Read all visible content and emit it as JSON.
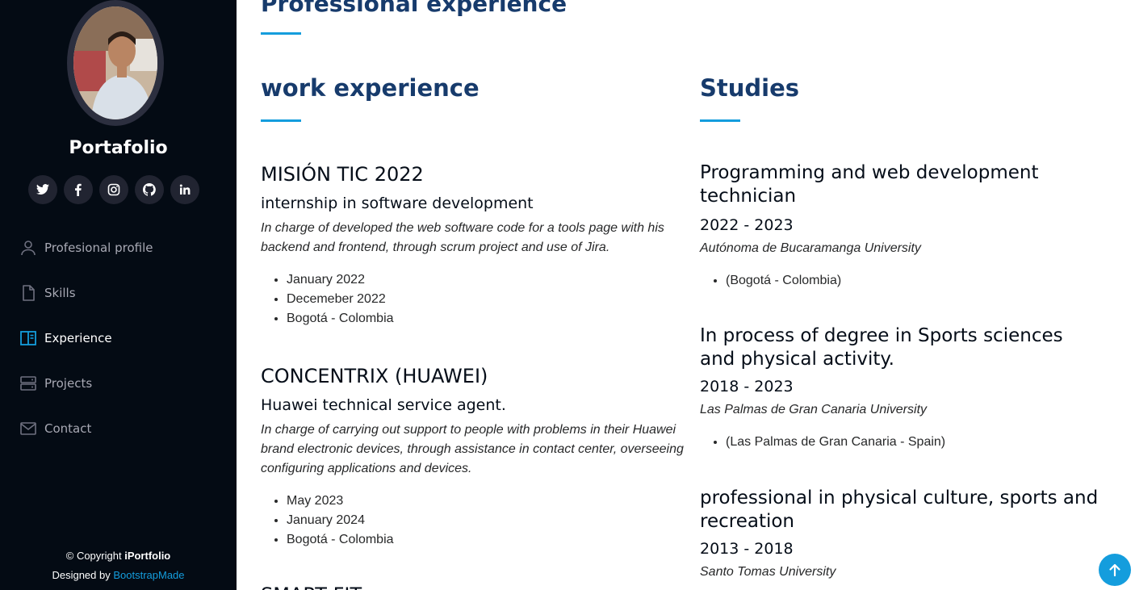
{
  "sidebar": {
    "brand": "Portafolio",
    "socials": [
      {
        "icon": "twitter-icon"
      },
      {
        "icon": "facebook-icon"
      },
      {
        "icon": "instagram-icon"
      },
      {
        "icon": "github-icon"
      },
      {
        "icon": "linkedin-icon"
      }
    ],
    "nav": [
      {
        "label": "Profesional profile",
        "icon": "person-icon"
      },
      {
        "label": "Skills",
        "icon": "file-icon"
      },
      {
        "label": "Experience",
        "icon": "book-columns-icon",
        "active": true
      },
      {
        "label": "Projects",
        "icon": "server-icon"
      },
      {
        "label": "Contact",
        "icon": "envelope-icon"
      }
    ],
    "footer": {
      "copyright_prefix": "© Copyright ",
      "copyright_brand": "iPortfolio",
      "designed_by": "Designed by ",
      "designer_link": "BootstrapMade"
    }
  },
  "main": {
    "page_title": "Professional experience",
    "work": {
      "title": "work experience",
      "items": [
        {
          "company": "MISIÓN TIC 2022",
          "role": "internship in software development",
          "description": "In charge of developed the web software code for a tools page with his backend and frontend, through scrum project and use of Jira.",
          "bullets": [
            "January 2022",
            "Decemeber 2022",
            "Bogotá - Colombia"
          ]
        },
        {
          "company": "CONCENTRIX (HUAWEI)",
          "role": "Huawei technical service agent.",
          "description": "In charge of carrying out support to people with problems in their Huawei brand electronic devices, through assistance in contact center, overseeing configuring applications and devices.",
          "bullets": [
            "May 2023",
            "January 2024",
            "Bogotá - Colombia"
          ]
        },
        {
          "company": "SMART FIT"
        }
      ]
    },
    "studies": {
      "title": "Studies",
      "items": [
        {
          "degree": "Programming and web development technician",
          "years": "2022 - 2023",
          "school": "Autónoma de Bucaramanga University",
          "bullets": [
            "(Bogotá - Colombia)"
          ]
        },
        {
          "degree": "In process of degree in Sports sciences and physical activity.",
          "years": "2018 - 2023",
          "school": "Las Palmas de Gran Canaria University",
          "bullets": [
            "(Las Palmas de Gran Canaria - Spain)"
          ]
        },
        {
          "degree": "professional in physical culture, sports and recreation",
          "years": "2013 - 2018",
          "school": "Santo Tomas University"
        }
      ]
    }
  },
  "colors": {
    "sidebar_bg": "#040b14",
    "accent": "#149ddd",
    "heading": "#173b6c"
  },
  "scroll_top": {
    "icon": "arrow-up-icon"
  }
}
